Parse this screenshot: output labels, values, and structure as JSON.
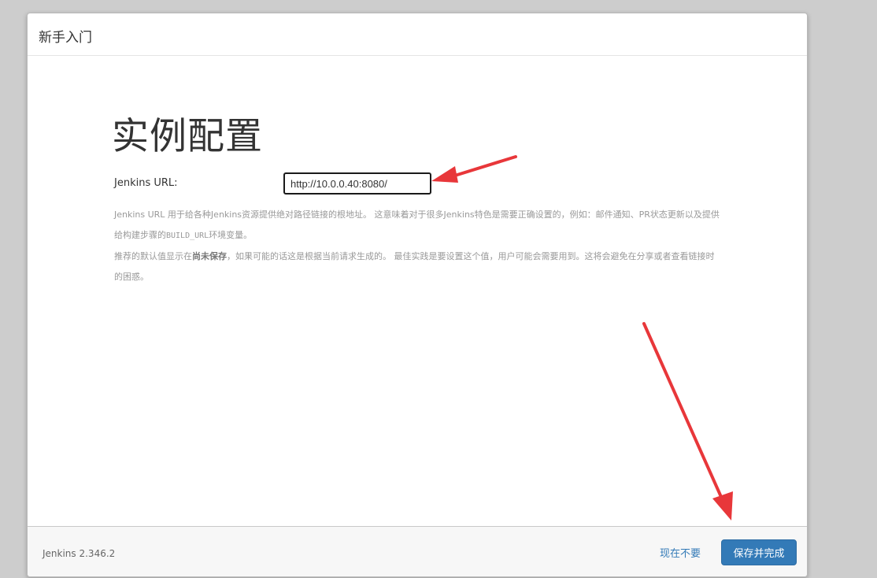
{
  "dialog": {
    "title": "新手入门"
  },
  "main": {
    "heading": "实例配置",
    "url_field": {
      "label": "Jenkins URL:",
      "value": "http://10.0.0.40:8080/"
    },
    "help": {
      "line1_part1": "Jenkins URL 用于给各种Jenkins资源提供绝对路径链接的根地址。 这意味着对于很多Jenkins特色是需要正确设置的，例如：邮件通知、PR状态更新以及提供给构建步骤的",
      "line1_code": "BUILD_URL",
      "line1_part2": "环境变量。",
      "line2_part1": "推荐的默认值显示在",
      "line2_strong": "尚未保存",
      "line2_part2": "，如果可能的话这是根据当前请求生成的。 最佳实践是要设置这个值，用户可能会需要用到。这将会避免在分享或者查看链接时的困惑。"
    }
  },
  "footer": {
    "version": "Jenkins 2.346.2",
    "skip_label": "现在不要",
    "save_label": "保存并完成"
  },
  "colors": {
    "primary": "#337ab7",
    "annotation_arrow": "#e8373a"
  }
}
